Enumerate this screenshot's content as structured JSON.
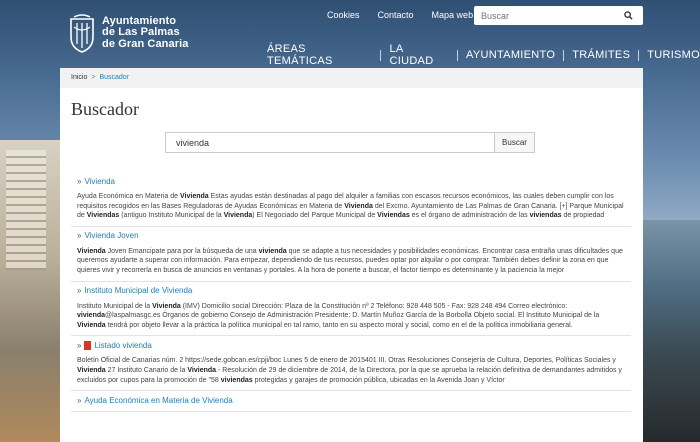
{
  "brand": {
    "name_line1": "Ayuntamiento",
    "name_line2": "de Las Palmas",
    "name_line3": "de Gran Canaria"
  },
  "top_links": [
    "Cookies",
    "Contacto",
    "Mapa web"
  ],
  "header_search": {
    "placeholder": "Buscar",
    "icon": "search-icon"
  },
  "main_nav": [
    "ÁREAS TEMÁTICAS",
    "LA CIUDAD",
    "AYUNTAMIENTO",
    "TRÁMITES",
    "TURISMO"
  ],
  "breadcrumb": {
    "home": "Inicio",
    "separator": ">",
    "current": "Buscador"
  },
  "page_title": "Buscador",
  "search": {
    "value": "vivienda",
    "button": "Buscar"
  },
  "results": [
    {
      "title": "Vivienda",
      "has_pdf_icon": false,
      "snippet_parts": [
        [
          "Ayuda Económica en Materia de ",
          false
        ],
        [
          "Vivienda",
          true
        ],
        [
          " Estas ayudas están destinadas al pago del alquiler a familias con escasos recursos económicos, las cuales deben cumplir con los requisitos recogidos en las Bases Reguladoras de Ayudas Económicas en Materia de ",
          false
        ],
        [
          "Vivienda",
          true
        ],
        [
          " del Excmo. Ayuntamiento de Las Palmas de Gran Canaria. [+] Parque Municipal de ",
          false
        ],
        [
          "Viviendas",
          true
        ],
        [
          " (antiguo Instituto Municipal de la ",
          false
        ],
        [
          "Vivienda",
          true
        ],
        [
          ") El Negociado del Parque Municipal de ",
          false
        ],
        [
          "Viviendas",
          true
        ],
        [
          " es el órgano de administración de las ",
          false
        ],
        [
          "viviendas",
          true
        ],
        [
          " de propiedad",
          false
        ]
      ]
    },
    {
      "title": "Vivienda Joven",
      "has_pdf_icon": false,
      "snippet_parts": [
        [
          "Vivienda",
          true
        ],
        [
          " Joven Emancipate para por la búsqueda de una ",
          false
        ],
        [
          "vivienda",
          true
        ],
        [
          " que se adapte a tus necesidades y posibilidades económicas. Encontrar casa entraña unas dificultades que queremos ayudarte a superar con información. Para empezar, dependiendo de tus recursos, puedes optar por alquilar o por comprar. También debes definir la zona en que quieres vivir y recorrerla en busca de anuncios en ventanas y portales. A la hora de ponerte a buscar, el factor tiempo es determinante y la paciencia la mejor",
          false
        ]
      ]
    },
    {
      "title": "Instituto Municipal de Vivienda",
      "has_pdf_icon": false,
      "snippet_parts": [
        [
          "Instituto Municipal de la ",
          false
        ],
        [
          "Vivienda",
          true
        ],
        [
          " (IMV) Domicilio social Dirección: Plaza de la Constitución nº 2 Teléfono: 928 448 505 - Fax: 928 248 494 Correo electrónico: ",
          false
        ],
        [
          "vivienda",
          true
        ],
        [
          "@laspalmasgc.es Órganos de gobierno Consejo de Administración Presidente: D. Martín Muñoz García de la Borbolla Objeto social. El Instituto Municipal de la ",
          false
        ],
        [
          "Vivienda",
          true
        ],
        [
          " tendrá por objeto llevar a la práctica la política municipal en tal ramo, tanto en su aspecto moral y social, como en el de la política inmobiliaria general.",
          false
        ]
      ]
    },
    {
      "title": "Listado vivienda",
      "has_pdf_icon": true,
      "snippet_parts": [
        [
          "Boletín Oficial de Canarias núm. 2 https://sede.gobcan.es/cpji/boc Lunes 5 de enero de 2015401 III. Otras Resoluciones Consejería de Cultura, Deportes, Políticas Sociales y ",
          false
        ],
        [
          "Vivienda",
          true
        ],
        [
          " 27 Instituto Canario de la ",
          false
        ],
        [
          "Vivienda",
          true
        ],
        [
          ".- Resolución de 29 de diciembre de 2014, de la Directora, por la que se aprueba la relación definitiva de demandantes admitidos y excluidos por cupos para la promoción de \"58 ",
          false
        ],
        [
          "viviendas",
          true
        ],
        [
          " protegidas y garajes de promoción pública, ubicadas en la Avenida Joan y Víctor",
          false
        ]
      ]
    },
    {
      "title": "Ayuda Económica en Materia de Vivienda",
      "has_pdf_icon": false,
      "snippet_parts": []
    }
  ]
}
